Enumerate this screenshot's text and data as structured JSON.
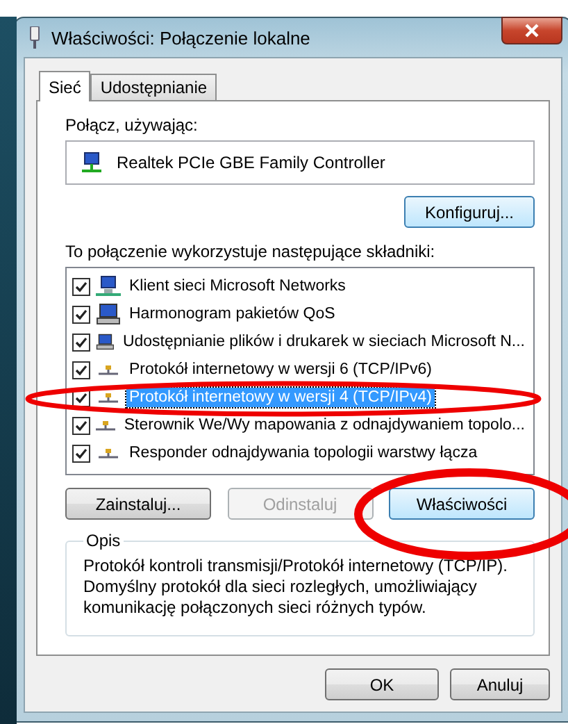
{
  "window": {
    "title": "Właściwości: Połączenie lokalne"
  },
  "tabs": [
    {
      "label": "Sieć",
      "selected": true
    },
    {
      "label": "Udostępnianie",
      "selected": false
    }
  ],
  "connect_using": {
    "label": "Połącz, używając:",
    "adapter": "Realtek PCIe GBE Family Controller",
    "configure_button": "Konfiguruj..."
  },
  "components": {
    "label": "To połączenie wykorzystuje następujące składniki:",
    "items": [
      {
        "kind": "client",
        "label": "Klient sieci Microsoft Networks",
        "checked": true,
        "selected": false
      },
      {
        "kind": "service",
        "label": "Harmonogram pakietów QoS",
        "checked": true,
        "selected": false
      },
      {
        "kind": "service",
        "label": "Udostępnianie plików i drukarek w sieciach Microsoft N...",
        "checked": true,
        "selected": false
      },
      {
        "kind": "protocol",
        "label": "Protokół internetowy w wersji 6 (TCP/IPv6)",
        "checked": true,
        "selected": false
      },
      {
        "kind": "protocol",
        "label": "Protokół internetowy w wersji 4 (TCP/IPv4)",
        "checked": true,
        "selected": true
      },
      {
        "kind": "protocol",
        "label": "Sterownik We/Wy mapowania z odnajdywaniem topolo...",
        "checked": true,
        "selected": false
      },
      {
        "kind": "protocol",
        "label": "Responder odnajdywania topologii warstwy łącza",
        "checked": true,
        "selected": false
      }
    ]
  },
  "action_buttons": [
    {
      "label": "Zainstaluj...",
      "disabled": false
    },
    {
      "label": "Odinstaluj",
      "disabled": true
    },
    {
      "label": "Właściwości",
      "disabled": false
    }
  ],
  "description": {
    "title": "Opis",
    "text": "Protokół kontroli transmisji/Protokół internetowy (TCP/IP). Domyślny protokół dla sieci rozległych, umożliwiający komunikację połączonych sieci różnych typów."
  },
  "dialog_buttons": [
    "OK",
    "Anuluj"
  ]
}
